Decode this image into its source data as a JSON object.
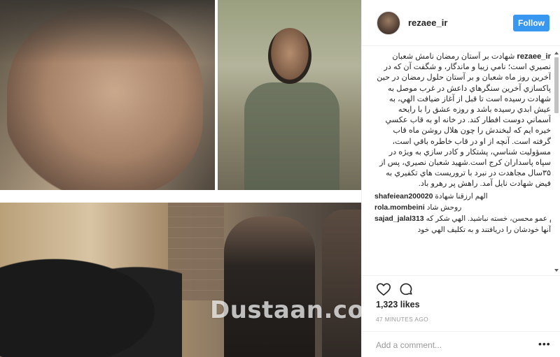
{
  "watermark": "Dustaan.com",
  "header": {
    "avatar_icon": "user-avatar-icon",
    "username": "rezaee_ir",
    "follow_label": "Follow",
    "follow_color": "#3897f0"
  },
  "caption": {
    "username": "rezaee_ir",
    "text": "شهادت بر آستان رمضان نامش شعبان نصيري است؛ نامي زيبا و ماندگار، و شگفت آن كه در آخرين روز ماه شعبان و بر آستان حلول رمضان در حين پاكسازي آخرين سنگرهاي داعش در غرب موصل به شهادت رسيده است تا قبل از آغاز ضيافت الهي، به عيش ابدي رسيده باشد و روزه عشق را با رايحه آسماني دوست افطار كند. در خانه او به قاب عكسي خيره ايم كه لبخندش را چون هلال روشن ماه قاب گرفته است. آنچه از او در قاب خاطره باقي است، مسؤوليت شناسي، پشتكار و كادر سازي به ويژه در سپاه پاسداران كرج است.شهيد شعبان نصيري، پس از ۳۵سال مجاهدت در نبرد با تروريست هاي تكفيري به فيض شهادت نايل آمد. راهش پر رهرو باد."
  },
  "comments": [
    {
      "user": "shafeiean200020",
      "text": "الهم ارزقنا شهادة"
    },
    {
      "user": "rola.mombeini",
      "text": "روحش شاد"
    },
    {
      "user": "sajad_jalal313",
      "text": "سلام عمو محسن، خسته نباشيد. الهي شكر كه"
    },
    {
      "user": "",
      "text": "آنها خودشان را دريافتند و به تكليف الهي خود"
    }
  ],
  "actions": {
    "like_icon": "heart-icon",
    "comment_icon": "comment-bubble-icon"
  },
  "likes_text": "1,323 likes",
  "timestamp": "47 MINUTES AGO",
  "add_comment": {
    "placeholder": "Add a comment...",
    "more_icon": "more-options-icon"
  }
}
